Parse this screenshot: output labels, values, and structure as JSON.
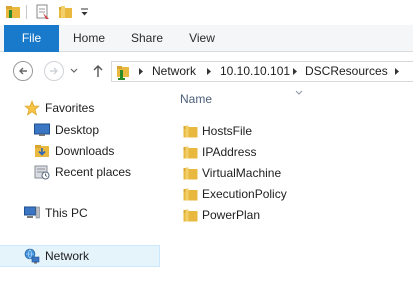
{
  "ribbon": {
    "tabs": [
      {
        "label": "File"
      },
      {
        "label": "Home"
      },
      {
        "label": "Share"
      },
      {
        "label": "View"
      }
    ]
  },
  "address_bar": {
    "breadcrumbs": [
      {
        "label": "Network"
      },
      {
        "label": "10.10.10.101"
      },
      {
        "label": "DSCResources"
      }
    ]
  },
  "nav_pane": {
    "favorites_label": "Favorites",
    "favorites": [
      {
        "label": "Desktop",
        "icon": "desktop-icon"
      },
      {
        "label": "Downloads",
        "icon": "downloads-icon"
      },
      {
        "label": "Recent places",
        "icon": "recent-places-icon"
      }
    ],
    "this_pc_label": "This PC",
    "network_label": "Network"
  },
  "content": {
    "column_name": "Name",
    "items": [
      {
        "name": "HostsFile"
      },
      {
        "name": "IPAddress"
      },
      {
        "name": "VirtualMachine"
      },
      {
        "name": "ExecutionPolicy"
      },
      {
        "name": "PowerPlan"
      }
    ]
  },
  "colors": {
    "file_tab": "#1979ca",
    "selection": "#e5f3fb",
    "folder": "#e8b93e",
    "header_text": "#4c607a"
  }
}
